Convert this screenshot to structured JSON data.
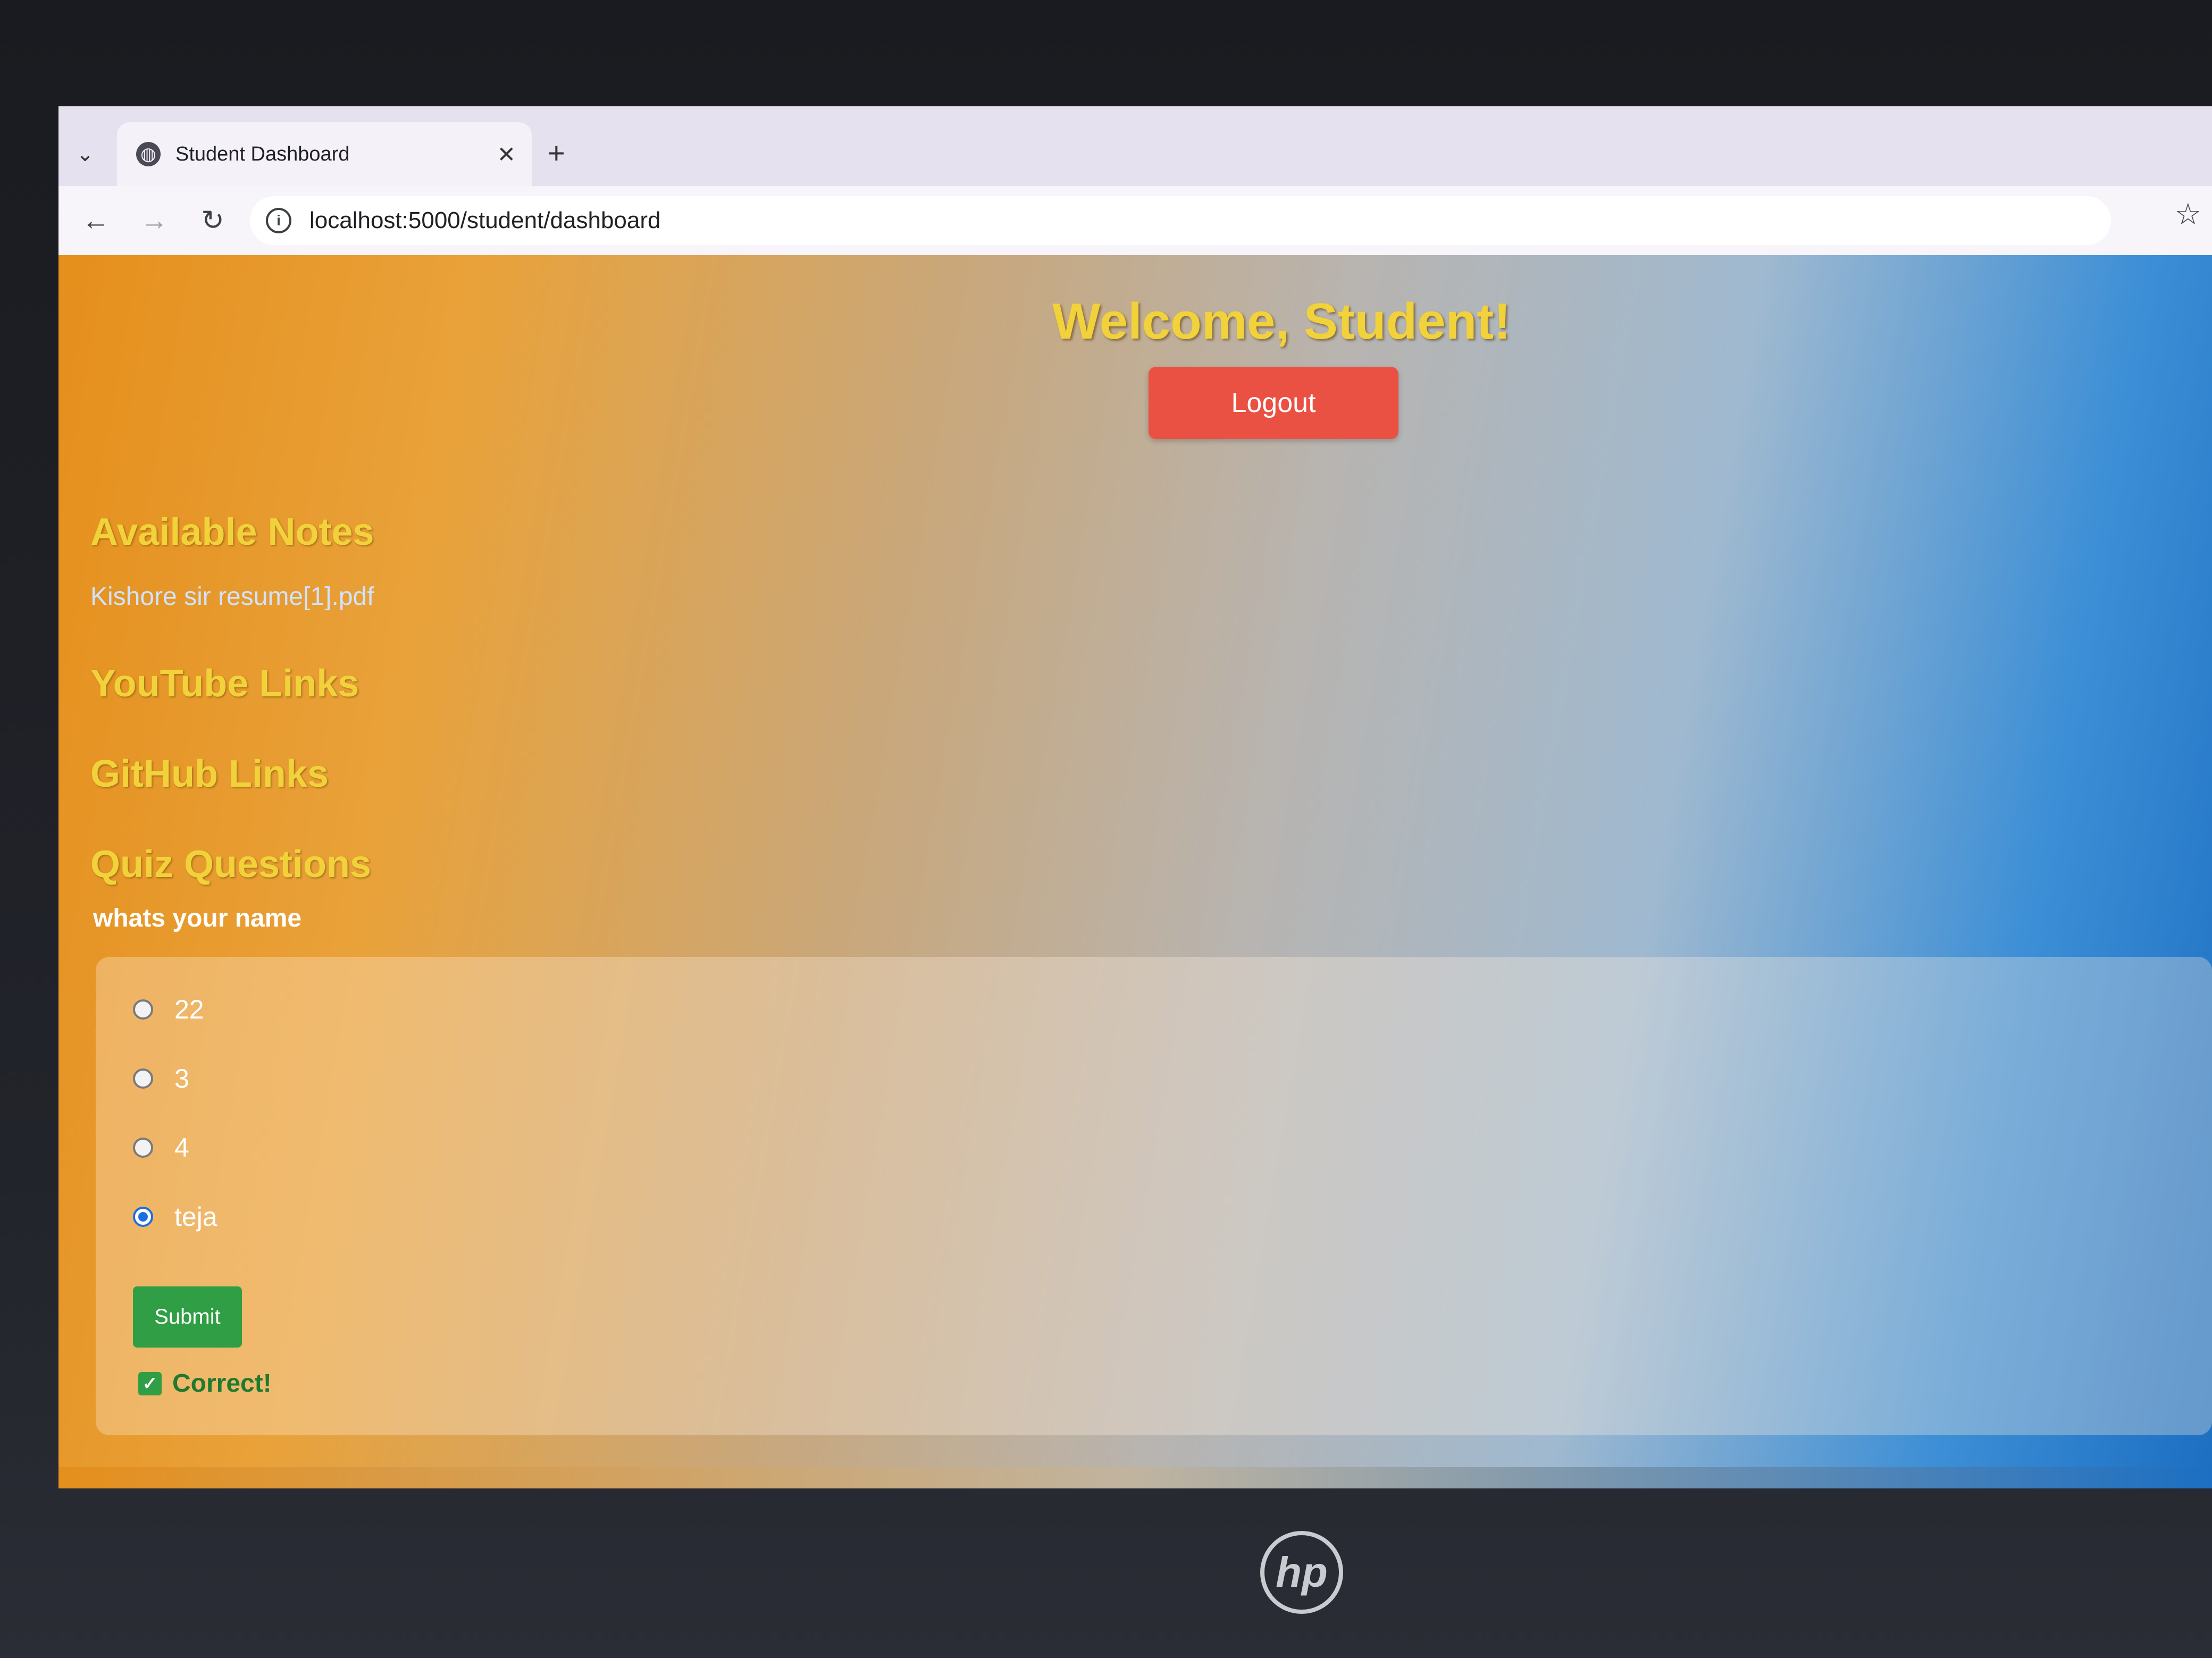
{
  "browser": {
    "tab_title": "Student Dashboard",
    "url": "localhost:5000/student/dashboard"
  },
  "page": {
    "welcome": "Welcome, Student!",
    "logout_label": "Logout",
    "sections": {
      "notes_title": "Available Notes",
      "notes": [
        "Kishore sir resume[1].pdf"
      ],
      "youtube_title": "YouTube Links",
      "github_title": "GitHub Links",
      "quiz_title": "Quiz Questions"
    },
    "quiz": {
      "question": "whats your name",
      "options": [
        "22",
        "3",
        "4",
        "teja"
      ],
      "selected": "teja",
      "submit_label": "Submit",
      "result": "Correct!"
    }
  },
  "device": {
    "logo": "hp"
  },
  "colors": {
    "heading_yellow": "#f2d23a",
    "logout_red": "#ea5142",
    "submit_green": "#2f9e44",
    "gradient_orange": "#e58f1c",
    "gradient_blue": "#1c6fc2"
  }
}
